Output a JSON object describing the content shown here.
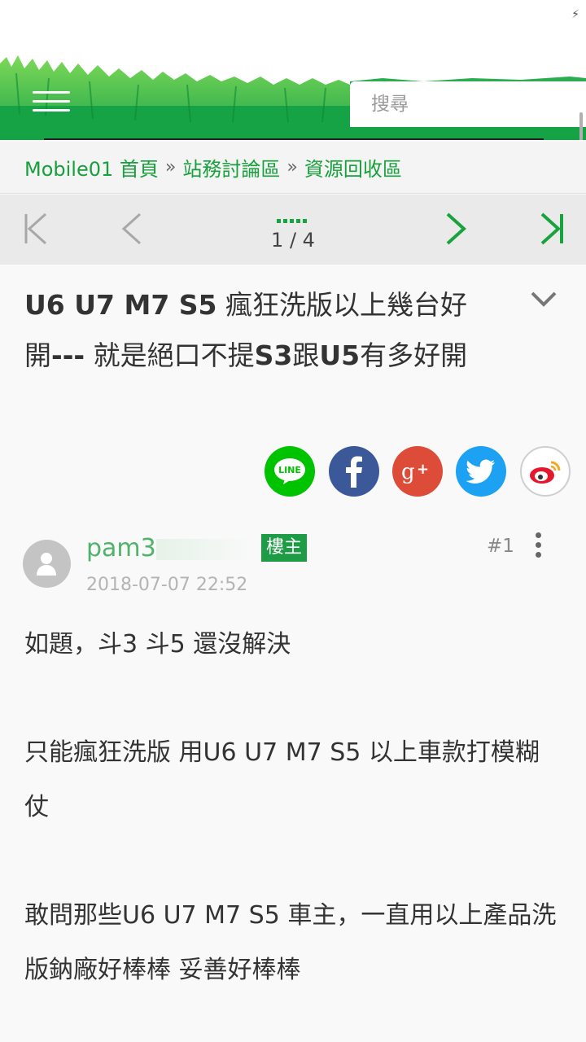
{
  "status_bar": {
    "battery_icon": "bolt-icon"
  },
  "header": {
    "menu_icon": "hamburger-menu-icon",
    "search_placeholder": "搜尋",
    "brand_color": "#21a347"
  },
  "breadcrumb": {
    "items": [
      "Mobile01 首頁",
      "站務討論區",
      "資源回收區"
    ],
    "separator": "»"
  },
  "pager": {
    "first_icon": "first-page-icon",
    "prev_icon": "prev-page-icon",
    "next_icon": "next-page-icon",
    "last_icon": "last-page-icon",
    "page_indicator": "1 / 4"
  },
  "thread": {
    "title_part1": "U6 U7 M7 S5",
    "title_part2": " 瘋狂洗版以上幾台好開",
    "title_part3": "---",
    "title_part4": " 就是絕口不提",
    "title_part5": "S3",
    "title_part6": "跟",
    "title_part7": "U5",
    "title_part8": "有多好開"
  },
  "share": {
    "line_label": "LINE",
    "colors": {
      "line": "#00c300",
      "facebook": "#3b5998",
      "googleplus": "#dd4b39",
      "twitter": "#1da1f2",
      "weibo": "#e6162d"
    }
  },
  "post": {
    "author": "pam3",
    "owner_badge": "樓主",
    "date": "2018-07-07 22:52",
    "floor": "#1",
    "paragraphs": [
      "如題，斗3 斗5 還沒解決",
      "只能瘋狂洗版 用U6 U7 M7 S5 以上車款打模糊仗",
      "敢問那些U6 U7 M7 S5 車主，一直用以上產品洗版鈉廠好棒棒 妥善好棒棒"
    ]
  }
}
